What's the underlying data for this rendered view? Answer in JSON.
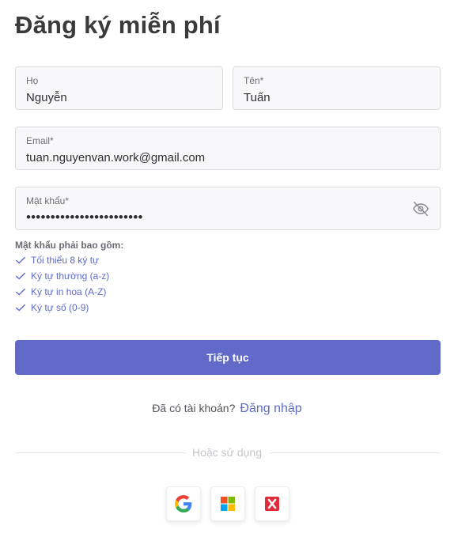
{
  "page": {
    "title": "Đăng ký miễn phí"
  },
  "form": {
    "last_name": {
      "label": "Họ",
      "value": "Nguyễn"
    },
    "first_name": {
      "label": "Tên*",
      "value": "Tuấn"
    },
    "email": {
      "label": "Email*",
      "value": "tuan.nguyenvan.work@gmail.com"
    },
    "password": {
      "label": "Mật khẩu*",
      "value": "••••••••••••••••••••••••",
      "visibility_icon": "eye-off-icon"
    }
  },
  "password_rules": {
    "title": "Mật khẩu phải bao gồm:",
    "items": [
      {
        "label": "Tối thiểu 8 ký tự",
        "icon": "check-icon"
      },
      {
        "label": "Ký tự thường (a-z)",
        "icon": "check-icon"
      },
      {
        "label": "Ký tự in hoa (A-Z)",
        "icon": "check-icon"
      },
      {
        "label": "Ký tự số (0-9)",
        "icon": "check-icon"
      }
    ]
  },
  "actions": {
    "continue_label": "Tiếp tục"
  },
  "login": {
    "prompt": "Đã có tài khoản?",
    "link_label": "Đăng nhập"
  },
  "alt_login": {
    "divider_text": "Hoặc sử dụng",
    "providers": [
      {
        "icon": "google-icon"
      },
      {
        "icon": "microsoft-icon"
      },
      {
        "icon": "red-x-icon"
      }
    ]
  },
  "colors": {
    "accent": "#6169c9",
    "link": "#5f6ac8",
    "field_bg": "#f8f8fb",
    "border": "#dcdce3"
  }
}
